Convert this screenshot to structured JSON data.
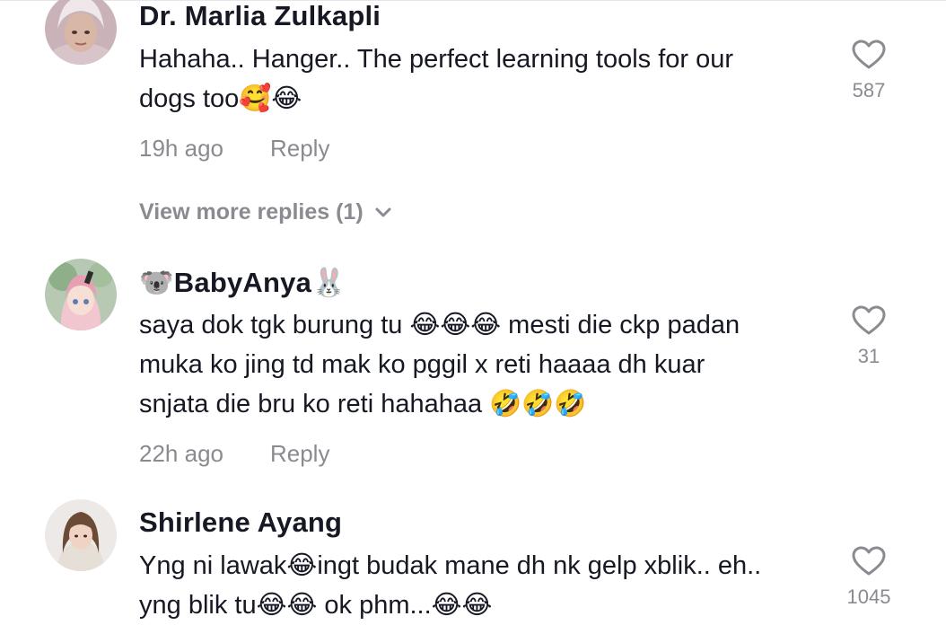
{
  "colors": {
    "text": "#161823",
    "secondary": "#8a8b91",
    "heart_outline": "#8a8b91",
    "background": "#ffffff"
  },
  "comments": [
    {
      "username": "Dr. Marlia Zulkapli",
      "text_lines": [
        "Hahaha.. Hanger.. The perfect learning tools for our",
        "dogs too🥰😂"
      ],
      "time": "19h ago",
      "reply_label": "Reply",
      "likes": "587",
      "like_icon": "heart-outline-icon",
      "view_more_label": "View more replies (1)"
    },
    {
      "username": "🐨BabyAnya🐰",
      "text_lines": [
        "saya dok tgk burung tu 😂😂😂 mesti die ckp padan",
        "muka ko jing td mak ko pggil x reti haaaa dh kuar",
        "snjata die bru ko reti hahahaa 🤣🤣🤣"
      ],
      "time": "22h ago",
      "reply_label": "Reply",
      "likes": "31",
      "like_icon": "heart-outline-icon"
    },
    {
      "username": "Shirlene Ayang",
      "text_lines": [
        "Yng ni lawak😂ingt budak mane dh nk gelp xblik.. eh..",
        "yng blik tu😂😂 ok phm...😂😂"
      ],
      "likes": "1045",
      "like_icon": "heart-outline-icon"
    }
  ]
}
